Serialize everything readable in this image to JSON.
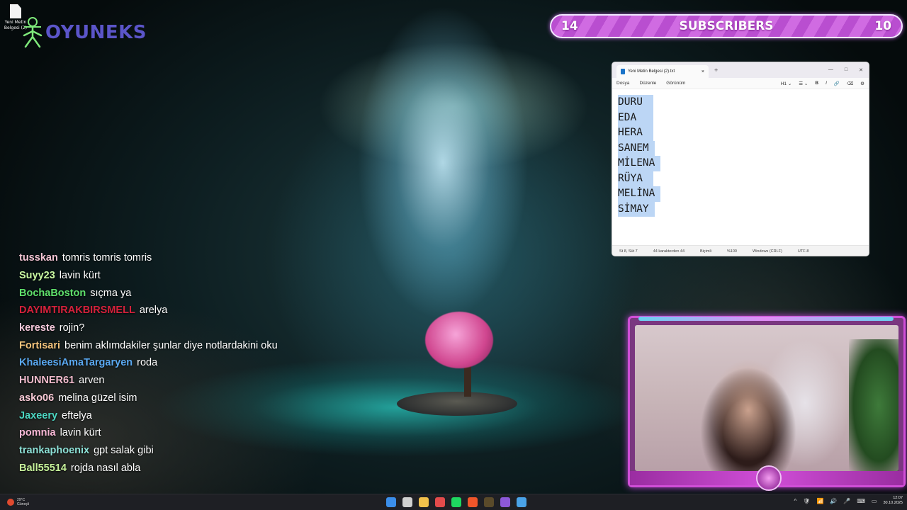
{
  "desktop": {
    "icon_label": "Yeni Metin Belgesi (2)"
  },
  "logo": {
    "text": "OYUNEKS"
  },
  "subscribers_bar": {
    "left_count": "14",
    "label": "SUBSCRIBERS",
    "right_count": "10"
  },
  "notepad": {
    "tab_title": "Yeni Metin Belgesi (2).txt",
    "tab_close": "×",
    "new_tab": "+",
    "win_controls": [
      "—",
      "□",
      "✕"
    ],
    "menu": [
      "Dosya",
      "Düzenle",
      "Görünüm"
    ],
    "toolbar": [
      "H1 ⌄",
      "☰ ⌄",
      "B",
      "I",
      "🔗",
      "⌫",
      "⚙"
    ],
    "lines": [
      "DURU",
      "EDA",
      "HERA",
      "SANEM",
      "MİLENA",
      "RÜYA",
      "MELİNA",
      "SİMAY"
    ],
    "status": {
      "position": "St 8, Süt 7",
      "chars": "44 karakterden 44",
      "format": "Biçimli",
      "zoom": "%100",
      "line_ending": "Windows (CRLF)",
      "encoding": "UTF-8"
    }
  },
  "chat": {
    "messages": [
      {
        "user": "tusskan",
        "text": "tomris tomris tomris",
        "color": "#f3c5d4"
      },
      {
        "user": "Suyy23",
        "text": "lavin kürt",
        "color": "#c9f7a1"
      },
      {
        "user": "BochaBoston",
        "text": "sıçma ya",
        "color": "#5fe06b"
      },
      {
        "user": "DAYIMTIRAKBIRSMELL",
        "text": "arelya",
        "color": "#d4213b"
      },
      {
        "user": "kereste",
        "text": "rojin?",
        "color": "#f6c9dc"
      },
      {
        "user": "Fortisari",
        "text": "benim aklımdakiler şunlar diye notlardakini oku",
        "color": "#f3c27b"
      },
      {
        "user": "KhaleesiAmaTargaryen",
        "text": "roda",
        "color": "#5aa9f2"
      },
      {
        "user": "HUNNER61",
        "text": "arven",
        "color": "#f2bccd"
      },
      {
        "user": "asko06",
        "text": "melina güzel isim",
        "color": "#f7c9d5"
      },
      {
        "user": "Jaxeery",
        "text": "eftelya",
        "color": "#4cd6c2"
      },
      {
        "user": "pomnia",
        "text": "lavin kürt",
        "color": "#f8b8d6"
      },
      {
        "user": "trankaphoenix",
        "text": "gpt salak gibi",
        "color": "#8de0d6"
      },
      {
        "user": "Ball55514",
        "text": "rojda nasıl abla",
        "color": "#c6f29a"
      }
    ]
  },
  "taskbar": {
    "weather_temp": "29°C",
    "weather_desc": "Güneşli",
    "time": "12:07",
    "date": "30.10.2025",
    "apps": [
      {
        "name": "windows-start",
        "color": "#3b8eea"
      },
      {
        "name": "task-view",
        "color": "#d0d0d0"
      },
      {
        "name": "file-explorer",
        "color": "#f2c14b"
      },
      {
        "name": "app-red",
        "color": "#e34b4b"
      },
      {
        "name": "spotify",
        "color": "#1ed760"
      },
      {
        "name": "brave",
        "color": "#f0562a"
      },
      {
        "name": "app-dark",
        "color": "#5a4a2a"
      },
      {
        "name": "obs",
        "color": "#8c58d8"
      },
      {
        "name": "notepad",
        "color": "#4aa3e8"
      }
    ],
    "tray_icons": [
      "^",
      "🛡",
      "📶",
      "🔊",
      "🎤",
      "⌨",
      "▭",
      "🔋",
      "📶",
      "🔊"
    ]
  }
}
